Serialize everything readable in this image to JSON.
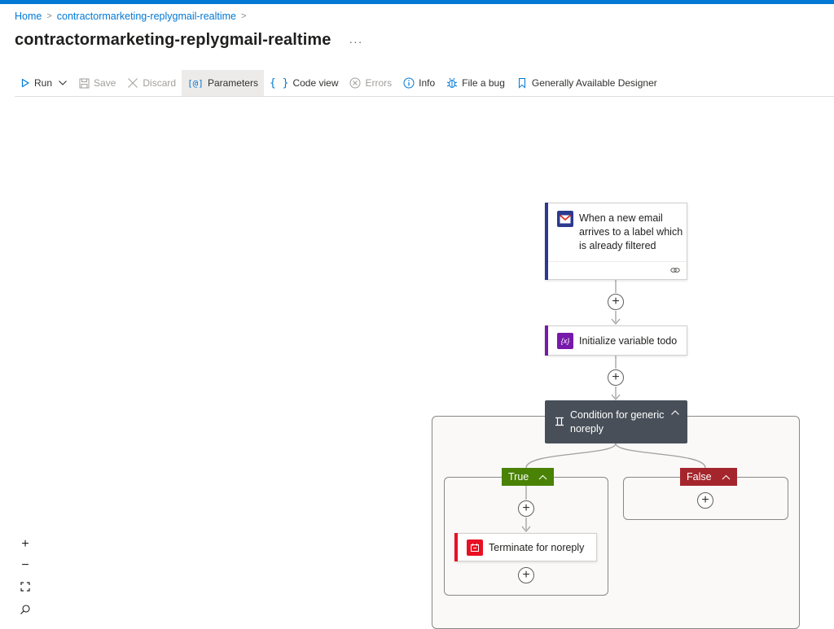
{
  "breadcrumb": {
    "home": "Home",
    "separator": ">",
    "item": "contractormarketing-replygmail-realtime",
    "trailing_separator": ">"
  },
  "page": {
    "title": "contractormarketing-replygmail-realtime",
    "more": "···"
  },
  "toolbar": {
    "run": "Run",
    "save": "Save",
    "discard": "Discard",
    "parameters": "Parameters",
    "code_view": "Code view",
    "errors": "Errors",
    "info": "Info",
    "file_bug": "File a bug",
    "designer": "Generally Available Designer"
  },
  "flow": {
    "trigger": {
      "text": "When a new email arrives to a label which is already filtered",
      "icon": "gmail-icon",
      "accent": "#2b3a8f"
    },
    "variable": {
      "text": "Initialize variable todo",
      "icon": "variable-icon",
      "accent": "#7719aa"
    },
    "condition": {
      "text": "Condition for generic noreply",
      "icon": "condition-icon"
    },
    "true_branch": {
      "label": "True",
      "color": "#498205"
    },
    "false_branch": {
      "label": "False",
      "color": "#a4262c"
    },
    "terminate": {
      "text": "Terminate for noreply",
      "icon": "terminate-icon",
      "accent": "#e81123"
    }
  },
  "zoom": {
    "in": "+",
    "out": "−"
  }
}
